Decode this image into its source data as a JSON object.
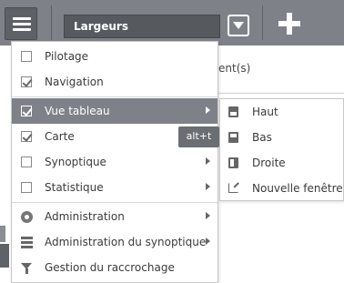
{
  "toolbar": {
    "search_value": "Largeurs"
  },
  "background": {
    "partial_text": "ent(s)"
  },
  "menu": {
    "items": [
      {
        "label": "Pilotage",
        "checked": false
      },
      {
        "label": "Navigation",
        "checked": true
      },
      {
        "label": "Vue tableau",
        "checked": true,
        "has_submenu": true,
        "active": true
      },
      {
        "label": "Carte",
        "checked": true
      },
      {
        "label": "Synoptique",
        "checked": false,
        "has_submenu": true
      },
      {
        "label": "Statistique",
        "checked": false,
        "has_submenu": true
      },
      {
        "label": "Administration",
        "icon": "gear-icon",
        "has_submenu": true
      },
      {
        "label": "Administration du synoptique",
        "icon": "list-icon",
        "has_submenu": true
      },
      {
        "label": "Gestion du raccrochage",
        "icon": "filter-icon"
      }
    ]
  },
  "tooltip": {
    "text": "alt+t"
  },
  "submenu": {
    "items": [
      {
        "label": "Haut",
        "icon": "pane-top-icon"
      },
      {
        "label": "Bas",
        "icon": "pane-bottom-icon"
      },
      {
        "label": "Droite",
        "icon": "pane-right-icon"
      },
      {
        "label": "Nouvelle fenêtre",
        "icon": "external-link-icon"
      }
    ]
  },
  "colors": {
    "toolbar_bg": "#7e8288",
    "active_item_bg": "#7e8288",
    "tooltip_bg": "#6b6e72"
  }
}
